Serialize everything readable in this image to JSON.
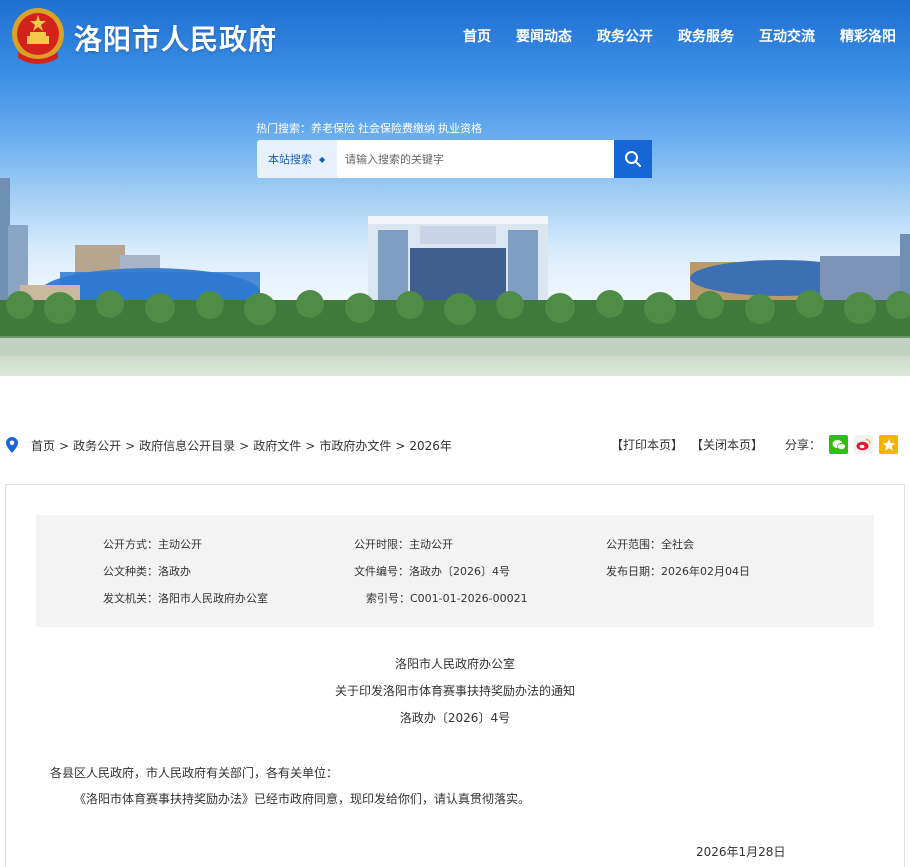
{
  "header": {
    "site_name": "洛阳市人民政府",
    "nav": [
      "首页",
      "要闻动态",
      "政务公开",
      "政务服务",
      "互动交流",
      "精彩洛阳"
    ]
  },
  "search": {
    "hot_label": "热门搜索：",
    "hot_items": [
      "养老保险",
      "社会保险费缴纳",
      "执业资格"
    ],
    "scope": "本站搜索",
    "placeholder": "请输入搜索的关键字"
  },
  "breadcrumb": [
    "首页",
    "政务公开",
    "政府信息公开目录",
    "政府文件",
    "市政府办文件",
    "2026年"
  ],
  "tools": {
    "print": "【打印本页】",
    "close": "【关闭本页】",
    "share": "分享："
  },
  "meta": {
    "r1c1": "公开方式：主动公开",
    "r1c2": "公开时限：主动公开",
    "r1c3": "公开范围：全社会",
    "r2c1": "公文种类：洛政办",
    "r2c2": "文件编号：洛政办〔2026〕4号",
    "r2c3": "发布日期：2026年02月04日",
    "r3c1": "发文机关：洛阳市人民政府办公室",
    "r3c2": "索引号：C001-01-2026-00021"
  },
  "document": {
    "issuer": "洛阳市人民政府办公室",
    "title": "关于印发洛阳市体育赛事扶持奖励办法的通知",
    "number": "洛政办〔2026〕4号",
    "salutation": "各县区人民政府，市人民政府有关部门，各有关单位：",
    "body": "《洛阳市体育赛事扶持奖励办法》已经市政府同意，现印发给你们，请认真贯彻落实。",
    "date": "2026年1月28日"
  },
  "colors": {
    "brand_blue": "#1766d6",
    "wechat_green": "#2dc100",
    "weibo_red": "#e6162d",
    "star_yellow": "#f5b400"
  }
}
